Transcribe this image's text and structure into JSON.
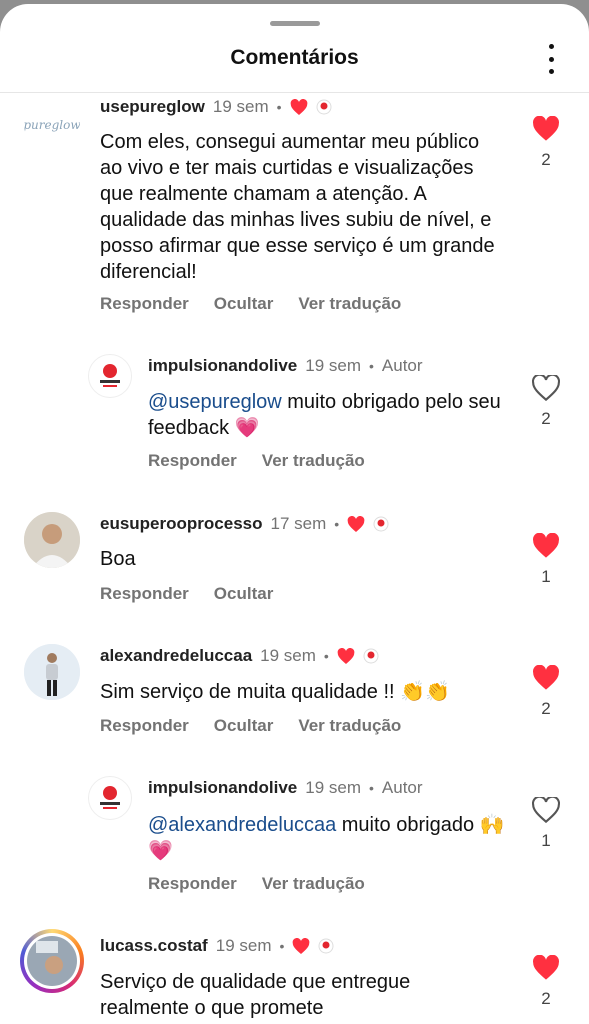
{
  "header": {
    "title": "Comentários"
  },
  "comments": [
    {
      "username": "usepureglow",
      "time": "19 sem",
      "avatar_text": "pureglow",
      "text": "Com eles, consegui aumentar meu público ao vivo e ter mais curtidas e visualizações que realmente chamam a atenção. A qualidade das minhas lives subiu de nível, e posso afirmar que esse serviço é um grande diferencial!",
      "actions": [
        "Responder",
        "Ocultar",
        "Ver tradução"
      ],
      "like_count": "2",
      "liked": true
    },
    {
      "username": "impulsionandolive",
      "time": "19 sem",
      "author_label": "Autor",
      "mention": "@usepureglow",
      "text": " muito obrigado pelo seu feedback 💗",
      "actions": [
        "Responder",
        "Ver tradução"
      ],
      "like_count": "2",
      "liked": false
    },
    {
      "username": "eusuperooprocesso",
      "time": "17 sem",
      "text": "Boa",
      "actions": [
        "Responder",
        "Ocultar"
      ],
      "like_count": "1",
      "liked": true
    },
    {
      "username": "alexandredeluccaa",
      "time": "19 sem",
      "text": "Sim serviço de muita qualidade !! 👏👏",
      "actions": [
        "Responder",
        "Ocultar",
        "Ver tradução"
      ],
      "like_count": "2",
      "liked": true
    },
    {
      "username": "impulsionandolive",
      "time": "19 sem",
      "author_label": "Autor",
      "mention": "@alexandredeluccaa",
      "text": " muito obrigado 🙌💗",
      "actions": [
        "Responder",
        "Ver tradução"
      ],
      "like_count": "1",
      "liked": false
    },
    {
      "username": "lucass.costaf",
      "time": "19 sem",
      "text": "Serviço de qualidade que entregue realmente o que promete",
      "like_count": "2",
      "liked": true
    }
  ],
  "colors": {
    "like_red": "#ff3040",
    "mention_blue": "#1a4d8c",
    "muted_gray": "#737373"
  },
  "icons": {
    "liked": "heart-filled-icon",
    "not_liked": "heart-outline-icon",
    "more": "more-vertical-icon"
  }
}
